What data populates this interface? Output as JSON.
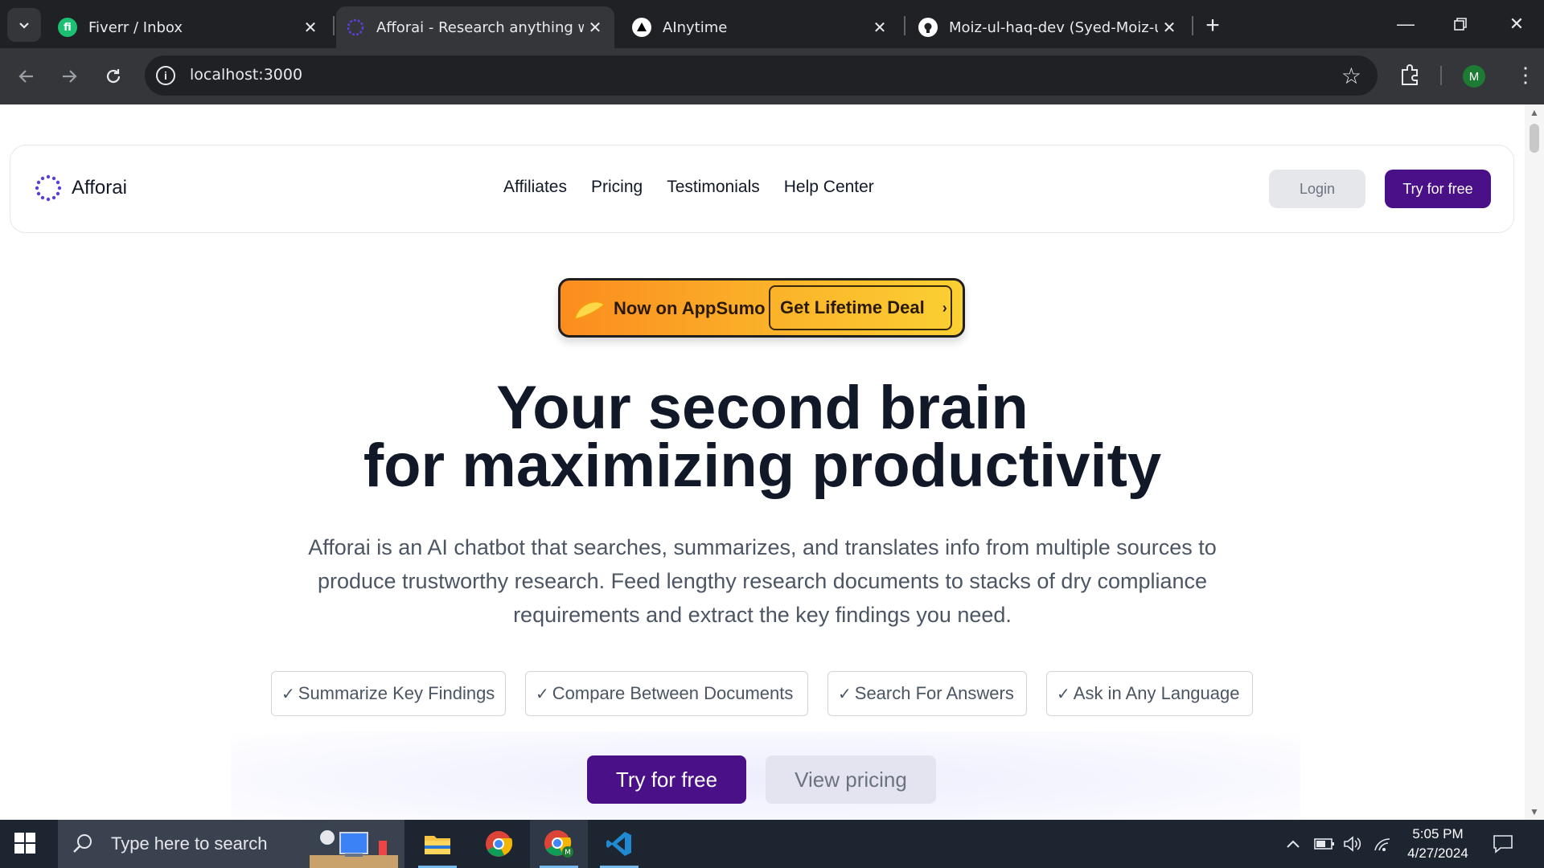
{
  "browser": {
    "tabs": [
      {
        "title": "Fiverr / Inbox",
        "icon": "fiverr-icon"
      },
      {
        "title": "Afforai - Research anything with",
        "icon": "afforai-icon"
      },
      {
        "title": "AInytime",
        "icon": "vercel-icon"
      },
      {
        "title": "Moiz-ul-haq-dev (Syed-Moiz-ul",
        "icon": "github-icon"
      }
    ],
    "url": "localhost:3000",
    "profile_initial": "M"
  },
  "site": {
    "brand": "Afforai",
    "nav": [
      "Affiliates",
      "Pricing",
      "Testimonials",
      "Help Center"
    ],
    "login_label": "Login",
    "try_label": "Try for free",
    "promo": {
      "left": "Now on AppSumo",
      "right": "Get Lifetime Deal"
    },
    "hero": {
      "line1": "Your second brain",
      "line2": "for maximizing productivity",
      "description": "Afforai is an AI chatbot that searches, summarizes, and translates info from multiple sources to produce trustworthy research. Feed lengthy research documents to stacks of dry compliance requirements and extract the key findings you need."
    },
    "features": [
      "Summarize Key Findings",
      "Compare Between Documents",
      "Search For Answers",
      "Ask in Any Language"
    ],
    "cta_primary": "Try for free",
    "cta_secondary": "View pricing"
  },
  "taskbar": {
    "search_placeholder": "Type here to search",
    "time": "5:05 PM",
    "date": "4/27/2024"
  },
  "colors": {
    "brand_purple": "#4a1087",
    "promo_orange": "#fb8c1e"
  }
}
